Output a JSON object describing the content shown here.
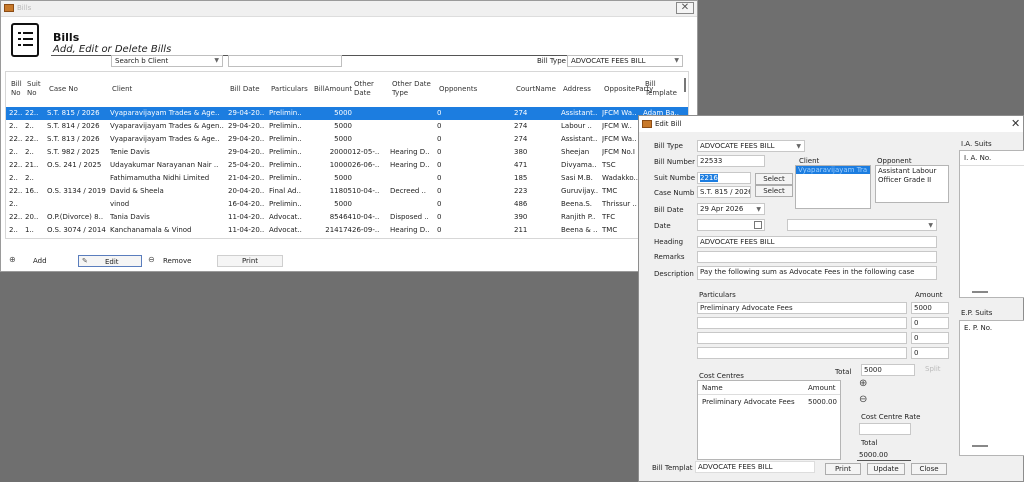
{
  "bills_window": {
    "title": "Bills",
    "heading": "Bills",
    "subheading": "Add, Edit or Delete Bills",
    "search_by_value": "Search b Client",
    "search_text": "",
    "bill_type_label": "Bill Type",
    "bill_type_value": "ADVOCATE FEES BILL",
    "close_icon": "close-icon",
    "table": {
      "headers": [
        "Bill No",
        "Suit No",
        "Case No",
        "Client",
        "Bill Date",
        "Particulars",
        "BillAmount",
        "Other Date",
        "Other Date Type",
        "Opponents",
        "CourtName",
        "Address",
        "OppositeParty",
        "Bill Template"
      ],
      "rows": [
        [
          "22..",
          "22..",
          "S.T. 815 / 2026",
          "Vyaparavijayam Trades & Age..",
          "29-04-20..",
          "Prelimin..",
          "5000",
          "",
          "",
          "0",
          "274",
          "Assistant..",
          "JFCM Wa..",
          "Adam Ba.."
        ],
        [
          "2..",
          "2..",
          "S.T. 814 / 2026",
          "Vyaparavijayam Trades & Agen..",
          "29-04-20..",
          "Prelimin..",
          "5000",
          "",
          "",
          "0",
          "274",
          "Labour ..",
          "JFCM W..",
          ""
        ],
        [
          "22..",
          "22..",
          "S.T. 813 / 2026",
          "Vyaparavijayam Trades & Age..",
          "29-04-20..",
          "Prelimin..",
          "5000",
          "",
          "",
          "0",
          "274",
          "Assistant..",
          "JFCM Wa..",
          ""
        ],
        [
          "2..",
          "2..",
          "S.T. 982 / 2025",
          "Tenie Davis",
          "29-04-20..",
          "Prelimin..",
          "20000",
          "12-05-..",
          "Hearing D..",
          "0",
          "380",
          "Sheejan",
          "JFCM No.I",
          ""
        ],
        [
          "22..",
          "21..",
          "O.S. 241 / 2025",
          "Udayakumar Narayanan Nair ..",
          "25-04-20..",
          "Prelimin..",
          "10000",
          "26-06-..",
          "Hearing D..",
          "0",
          "471",
          "Divyama..",
          "TSC",
          ""
        ],
        [
          "2..",
          "2..",
          "",
          "Fathimamutha Nidhi Limited",
          "21-04-20..",
          "Prelimin..",
          "5000",
          "",
          "",
          "0",
          "185",
          "Sasi M.B.",
          "Wadakko..",
          ""
        ],
        [
          "22..",
          "16..",
          "O.S. 3134 / 2019",
          "David & Sheela",
          "20-04-20..",
          "Final Ad..",
          "11805",
          "10-04-..",
          "Decreed ..",
          "0",
          "223",
          "Guruvijay..",
          "TMC",
          ""
        ],
        [
          "2..",
          "",
          "",
          "vinod",
          "16-04-20..",
          "Prelimin..",
          "5000",
          "",
          "",
          "0",
          "486",
          "Beena.S.",
          "Thrissur ..",
          ""
        ],
        [
          "22..",
          "20..",
          "O.P.(Divorce) 8..",
          "Tania Davis",
          "11-04-20..",
          "Advocat..",
          "85464",
          "10-04-..",
          "Disposed ..",
          "0",
          "390",
          "Ranjith P..",
          "TFC",
          ""
        ],
        [
          "2..",
          "1..",
          "O.S. 3074 / 2014",
          "Kanchanamala & Vinod",
          "11-04-20..",
          "Advocat..",
          "214174",
          "26-09-..",
          "Hearing D..",
          "0",
          "211",
          "Beena & ..",
          "TMC",
          ""
        ]
      ]
    },
    "buttons": {
      "add": "Add",
      "edit": "Edit",
      "remove": "Remove",
      "print": "Print"
    }
  },
  "edit_bill": {
    "title": "Edit Bill",
    "bill_type_label": "Bill Type",
    "bill_type_value": "ADVOCATE FEES BILL",
    "bill_number_label": "Bill Number",
    "bill_number_value": "22533",
    "suit_number_label": "Suit Numbe",
    "suit_number_value": "2216",
    "case_number_label": "Case Numb",
    "case_number_value": "S.T. 815 / 2026",
    "select_label": "Select",
    "bill_date_label": "Bill Date",
    "bill_date_value": "29 Apr 2026",
    "date_label": "Date",
    "heading_label": "Heading",
    "heading_value": "ADVOCATE FEES BILL",
    "remarks_label": "Remarks",
    "remarks_value": "",
    "description_label": "Description",
    "description_value": "Pay the following sum as Advocate Fees in the following case",
    "client_label": "Client",
    "client_value": "Vyaparavijayam Tra",
    "opponent_label": "Opponent",
    "opponent_value": "Assistant Labour Officer Grade II",
    "particulars_label": "Particulars",
    "amount_label": "Amount",
    "particulars": [
      {
        "name": "Preliminary Advocate Fees",
        "amount": "5000"
      },
      {
        "name": "",
        "amount": "0"
      },
      {
        "name": "",
        "amount": "0"
      },
      {
        "name": "",
        "amount": "0"
      }
    ],
    "total_label": "Total",
    "total_value": "5000",
    "split_label": "Split",
    "cost_centres_label": "Cost Centres",
    "cost_centre_headers": [
      "Name",
      "Amount"
    ],
    "cost_centres": [
      {
        "name": "Preliminary Advocate Fees",
        "amount": "5000.00"
      }
    ],
    "cost_centre_rate_label": "Cost Centre Rate",
    "cc_total_label": "Total",
    "cc_total_value": "5000.00",
    "bill_template_label": "Bill Templat",
    "bill_template_value": "ADVOCATE FEES BILL",
    "print_button": "Print",
    "update_button": "Update",
    "close_button": "Close",
    "ia_suits_label": "I.A. Suits",
    "ia_column": "I. A. No.",
    "ep_suits_label": "E.P. Suits",
    "ep_column": "E. P. No."
  }
}
